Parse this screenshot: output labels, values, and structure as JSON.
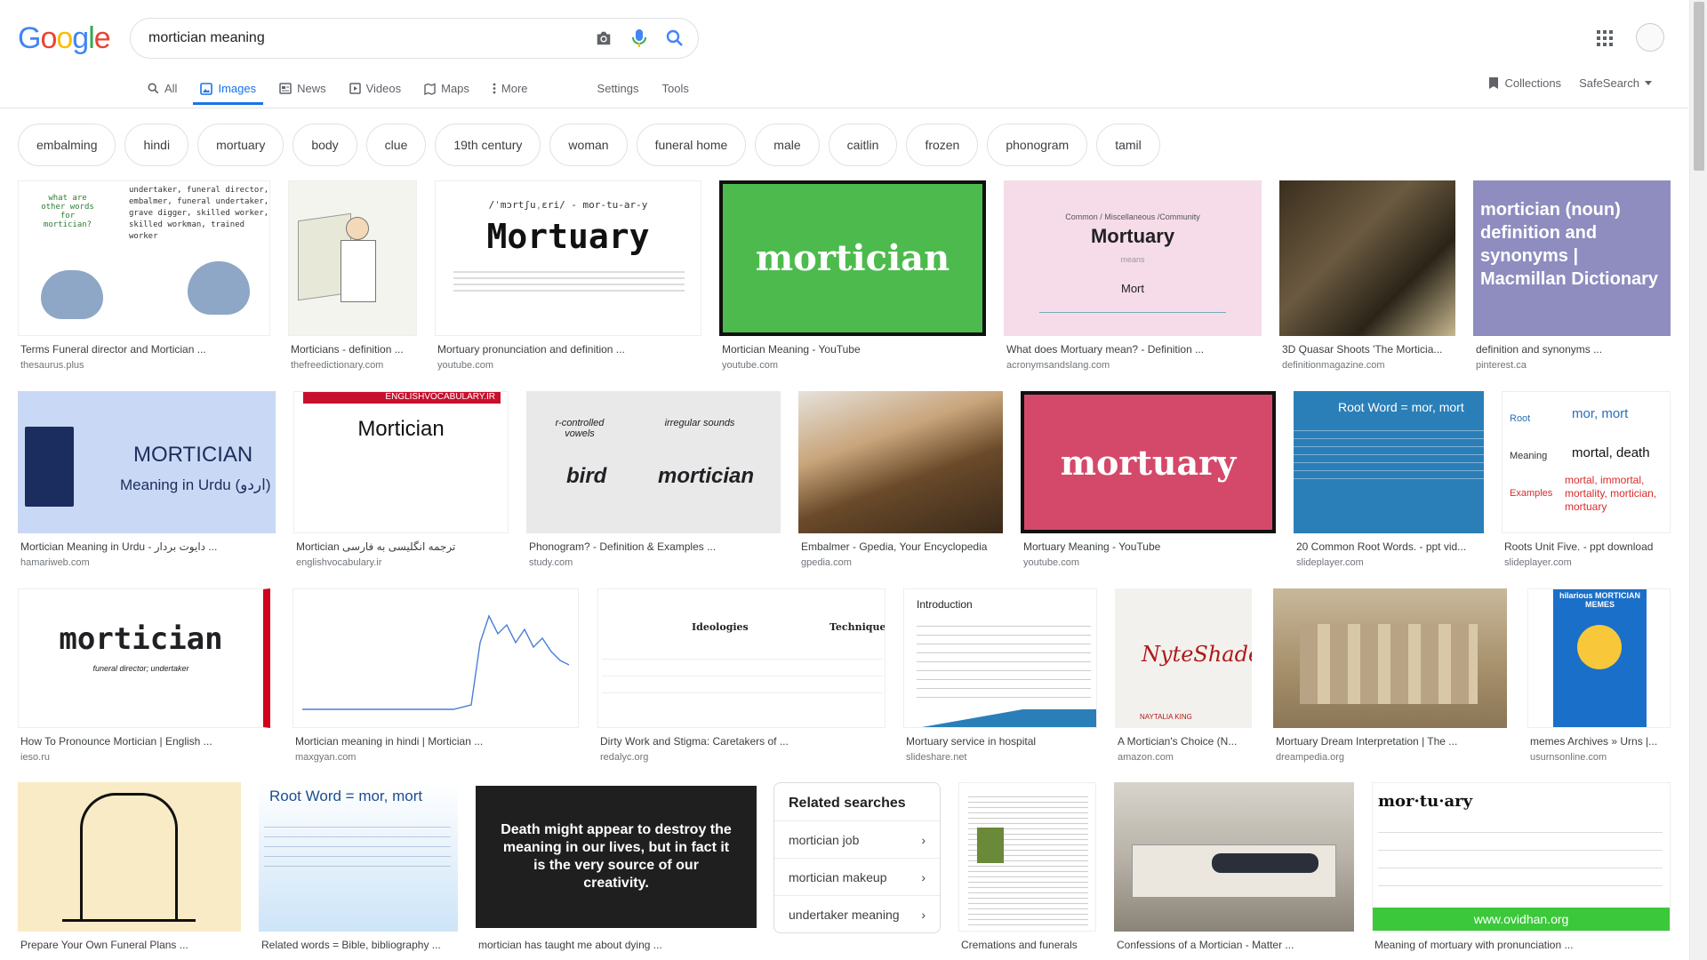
{
  "logo": [
    "G",
    "o",
    "o",
    "g",
    "l",
    "e"
  ],
  "search": {
    "query": "mortician meaning"
  },
  "tabs": [
    {
      "label": "All",
      "icon": "search-icon"
    },
    {
      "label": "Images",
      "icon": "image-icon",
      "active": true
    },
    {
      "label": "News",
      "icon": "news-icon"
    },
    {
      "label": "Videos",
      "icon": "video-icon"
    },
    {
      "label": "Maps",
      "icon": "map-icon"
    },
    {
      "label": "More",
      "icon": "more-vert-icon"
    }
  ],
  "tools": {
    "settings": "Settings",
    "tools": "Tools"
  },
  "header_right": {
    "collections": "Collections",
    "safesearch": "SafeSearch"
  },
  "chips": [
    "embalming",
    "hindi",
    "mortuary",
    "body",
    "clue",
    "19th century",
    "woman",
    "funeral home",
    "male",
    "caitlin",
    "frozen",
    "phonogram",
    "tamil"
  ],
  "results": [
    {
      "caption": "Terms Funeral director and Mortician ...",
      "source": "thesaurus.plus",
      "thumb_text": "undertaker, funeral director, embalmer, funeral undertaker, grave digger, skilled worker, skilled workman, trained worker",
      "thumb_text2": "what are other words for mortician?"
    },
    {
      "caption": "Morticians - definition ...",
      "source": "thefreedictionary.com"
    },
    {
      "caption": "Mortuary pronunciation and definition ...",
      "source": "youtube.com",
      "thumb_text": "Mortuary",
      "thumb_text2": "/ˈmɔrtʃuˌɛri/ - mor-tu-ar-y"
    },
    {
      "caption": "Mortician Meaning - YouTube",
      "source": "youtube.com",
      "thumb_text": "mortician"
    },
    {
      "caption": "What does Mortuary mean? - Definition ...",
      "source": "acronymsandslang.com",
      "thumb_text": "Mortuary",
      "thumb_text2": "Mort",
      "thumb_text3": "Common / Miscellaneous /Community",
      "thumb_text4": "means"
    },
    {
      "caption": "3D Quasar Shoots 'The Morticia...",
      "source": "definitionmagazine.com"
    },
    {
      "caption": "definition and synonyms ...",
      "source": "pinterest.ca",
      "thumb_text": "mortician (noun) definition and synonyms | Macmillan Dictionary"
    },
    {
      "caption": "Mortician Meaning in Urdu - دایوت بردار ...",
      "source": "hamariweb.com",
      "thumb_text": "MORTICIAN",
      "thumb_text2": "Meaning in Urdu (اردو)"
    },
    {
      "caption": "Mortician ترجمه انگلیسی به فارسی",
      "source": "englishvocabulary.ir",
      "thumb_text": "Mortician",
      "thumb_text2": "ENGLISHVOCABULARY.IR"
    },
    {
      "caption": "Phonogram? - Definition & Examples ...",
      "source": "study.com",
      "thumb_text": "bird",
      "thumb_text2": "mortician",
      "thumb_text3": "r-controlled vowels",
      "thumb_text4": "irregular sounds"
    },
    {
      "caption": "Embalmer - Gpedia, Your Encyclopedia",
      "source": "gpedia.com"
    },
    {
      "caption": "Mortuary Meaning - YouTube",
      "source": "youtube.com",
      "thumb_text": "mortuary"
    },
    {
      "caption": "20 Common Root Words. - ppt vid...",
      "source": "slideplayer.com",
      "thumb_text": "Root Word = mor, mort"
    },
    {
      "caption": "Roots Unit Five. - ppt download",
      "source": "slideplayer.com",
      "thumb_text": "mor, mort",
      "thumb_text2": "mortal, death",
      "thumb_text3": "mortal, immortal, mortality, mortician, mortuary"
    },
    {
      "caption": "How To Pronounce Mortician | English ...",
      "source": "ieso.ru",
      "thumb_text": "mortician",
      "thumb_text2": "funeral director; undertaker"
    },
    {
      "caption": "Mortician meaning in hindi | Mortician ...",
      "source": "maxgyan.com"
    },
    {
      "caption": "Dirty Work and Stigma: Caretakers of ...",
      "source": "redalyc.org",
      "thumb_text": "Ideologies",
      "thumb_text2": "Techniques"
    },
    {
      "caption": "Mortuary service in hospital",
      "source": "slideshare.net",
      "thumb_text": "Introduction"
    },
    {
      "caption": "A Mortician's Choice (N...",
      "source": "amazon.com",
      "thumb_text": "NyteShade",
      "thumb_text2": "NAYTALIA KING"
    },
    {
      "caption": "Mortuary Dream Interpretation | The ...",
      "source": "dreampedia.org"
    },
    {
      "caption": "memes Archives » Urns |...",
      "source": "usurnsonline.com",
      "thumb_text": "hilarious MORTICIAN MEMES"
    },
    {
      "caption": "Prepare Your Own Funeral Plans ...",
      "source": ""
    },
    {
      "caption": "Related words = Bible, bibliography ...",
      "source": "",
      "thumb_text": "Root Word = mor, mort"
    },
    {
      "caption": "mortician has taught me about dying ...",
      "source": "",
      "thumb_text": "Death might appear to destroy the meaning in our lives, but in fact it is the very source of our creativity."
    },
    {
      "caption": "Cremations and funerals",
      "source": ""
    },
    {
      "caption": "Confessions of a Mortician - Matter ...",
      "source": ""
    },
    {
      "caption": "Meaning of mortuary with pronunciation ...",
      "source": "",
      "thumb_text": "mor·tu·ary",
      "thumb_text2": "www.ovidhan.org"
    }
  ],
  "related": {
    "title": "Related searches",
    "items": [
      "mortician job",
      "mortician makeup",
      "undertaker meaning"
    ]
  }
}
